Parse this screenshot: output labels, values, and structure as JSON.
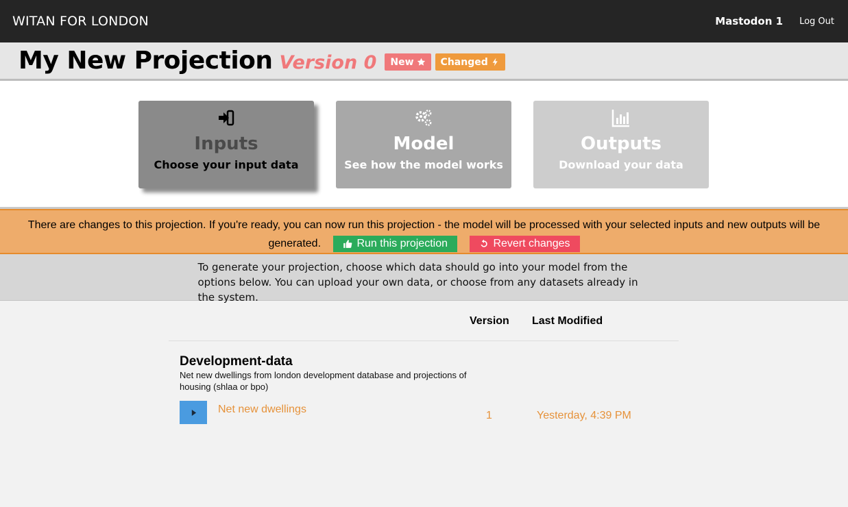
{
  "topbar": {
    "brand": "WITAN FOR LONDON",
    "username": "Mastodon 1",
    "logout_label": "Log Out"
  },
  "projection": {
    "title": "My New Projection",
    "version": "Version 0",
    "badge_new": "New",
    "badge_changed": "Changed"
  },
  "cards": {
    "inputs": {
      "title": "Inputs",
      "subtitle": "Choose your input data",
      "icon": "sign-in-icon"
    },
    "model": {
      "title": "Model",
      "subtitle": "See how the model works",
      "icon": "gears-icon"
    },
    "outputs": {
      "title": "Outputs",
      "subtitle": "Download your data",
      "icon": "bar-chart-icon"
    }
  },
  "notice": {
    "message": "There are changes to this projection. If you're ready, you can now run this projection - the model will be processed with your selected inputs and new outputs will be generated.",
    "run_label": "Run this projection",
    "revert_label": "Revert changes"
  },
  "info": {
    "text": "To generate your projection, choose which data should go into your model from the options below. You can upload your own data, or choose from any datasets already in the system."
  },
  "table": {
    "col_version": "Version",
    "col_modified": "Last Modified",
    "group": {
      "title": "Development-data",
      "description": "Net new dwellings from london development database and projections of housing (shlaa or bpo)",
      "dataset": {
        "name": "Net new dwellings",
        "version": "1",
        "modified": "Yesterday, 4:39 PM"
      }
    }
  },
  "colors": {
    "topbar": "#252525",
    "accent_orange": "#e6923a",
    "badge_new": "#f0787a",
    "badge_changed": "#ef9a3c",
    "run_button": "#2bab5b",
    "revert_button": "#ef4a5f",
    "play_button": "#4a9be0"
  }
}
